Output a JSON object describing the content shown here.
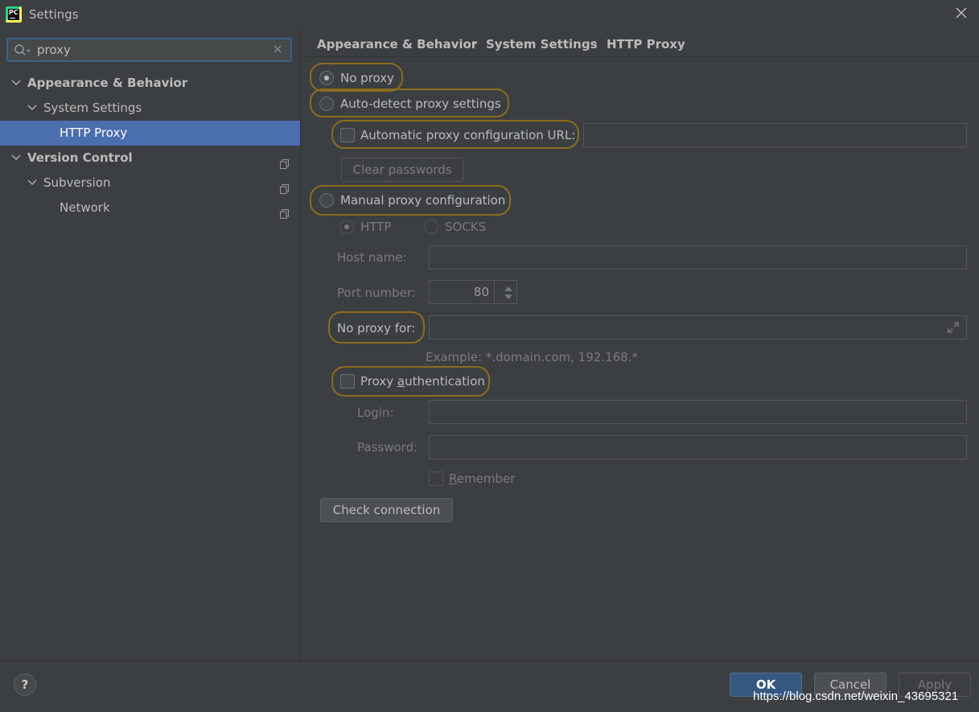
{
  "window": {
    "title": "Settings",
    "app_icon_text": "PC"
  },
  "search": {
    "value": "proxy"
  },
  "tree": {
    "items": [
      {
        "label": "Appearance & Behavior",
        "expanded": true
      },
      {
        "label": "System Settings",
        "expanded": true
      },
      {
        "label": "HTTP Proxy",
        "selected": true
      },
      {
        "label": "Version Control",
        "expanded": true
      },
      {
        "label": "Subversion",
        "expanded": true
      },
      {
        "label": "Network"
      }
    ]
  },
  "breadcrumb": {
    "items": [
      "Appearance & Behavior",
      "System Settings",
      "HTTP Proxy"
    ],
    "separator": "›"
  },
  "proxy": {
    "no_proxy": "No proxy",
    "auto_detect": "Auto-detect proxy settings",
    "auto_config_url": "Automatic proxy configuration URL:",
    "clear_passwords": "Clear passwords",
    "manual": "Manual proxy configuration",
    "http": "HTTP",
    "socks": "SOCKS",
    "host_name": "Host name:",
    "port_number": "Port number:",
    "port_value": "80",
    "no_proxy_for": "No proxy for:",
    "example": "Example: *.domain.com, 192.168.*",
    "proxy_auth_pre": "Proxy ",
    "proxy_auth_u": "a",
    "proxy_auth_post": "uthentication",
    "login": "Login:",
    "password": "Password:",
    "remember_u": "R",
    "remember_post": "emember",
    "check_connection": "Check connection",
    "selected_mode": "No proxy"
  },
  "footer": {
    "help": "?",
    "ok": "OK",
    "cancel": "Cancel",
    "apply": "Apply",
    "watermark": "https://blog.csdn.net/weixin_43695321"
  },
  "colors": {
    "highlight": "#8a6d1d",
    "selection": "#4b6eaf",
    "ok_button": "#365880"
  }
}
